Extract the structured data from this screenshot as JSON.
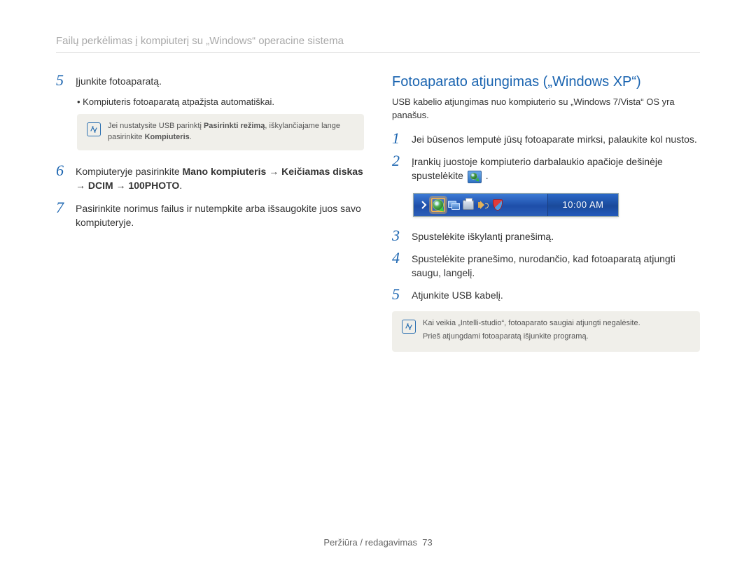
{
  "header": {
    "title": "Failų perkėlimas į kompiuterį su „Windows“ operacine sistema"
  },
  "left": {
    "steps": [
      {
        "num": "5",
        "text": "Įjunkite fotoaparatą."
      },
      {
        "num": "6",
        "text_before": "Kompiuteryje pasirinkite ",
        "bold": "Mano kompiuteris → Keičiamas diskas → DCIM → 100PHOTO",
        "text_after": "."
      },
      {
        "num": "7",
        "text": "Pasirinkite norimus failus ir nutempkite arba išsaugokite juos savo kompiuteryje."
      }
    ],
    "bullet": "Kompiuteris fotoaparatą atpažįsta automatiškai.",
    "note": {
      "part1": "Jei nustatysite USB parinktį ",
      "bold1": "Pasirinkti režimą",
      "part2": ", iškylančiajame lange pasirinkite ",
      "bold2": "Kompiuteris",
      "part3": "."
    }
  },
  "right": {
    "heading": "Fotoaparato atjungimas („Windows XP“)",
    "intro": "USB kabelio atjungimas nuo kompiuterio su „Windows 7/Vista“ OS yra panašus.",
    "steps": [
      {
        "num": "1",
        "text": "Jei būsenos lemputė jūsų fotoaparate mirksi, palaukite kol nustos."
      },
      {
        "num": "2",
        "text_before": "Įrankių juostoje kompiuterio darbalaukio apačioje dešinėje spustelėkite ",
        "has_icon": true,
        "text_after": " ."
      },
      {
        "num": "3",
        "text": "Spustelėkite iškylantį pranešimą."
      },
      {
        "num": "4",
        "text": "Spustelėkite pranešimo, nurodančio, kad fotoaparatą atjungti saugu, langelį."
      },
      {
        "num": "5",
        "text": "Atjunkite USB kabelį."
      }
    ],
    "taskbar_time": "10:00 AM",
    "note": {
      "line1": "Kai veikia „Intelli-studio“, fotoaparato saugiai atjungti negalėsite.",
      "line2": "Prieš atjungdami fotoaparatą išjunkite programą."
    }
  },
  "footer": {
    "label": "Peržiūra / redagavimas",
    "page": "73"
  }
}
